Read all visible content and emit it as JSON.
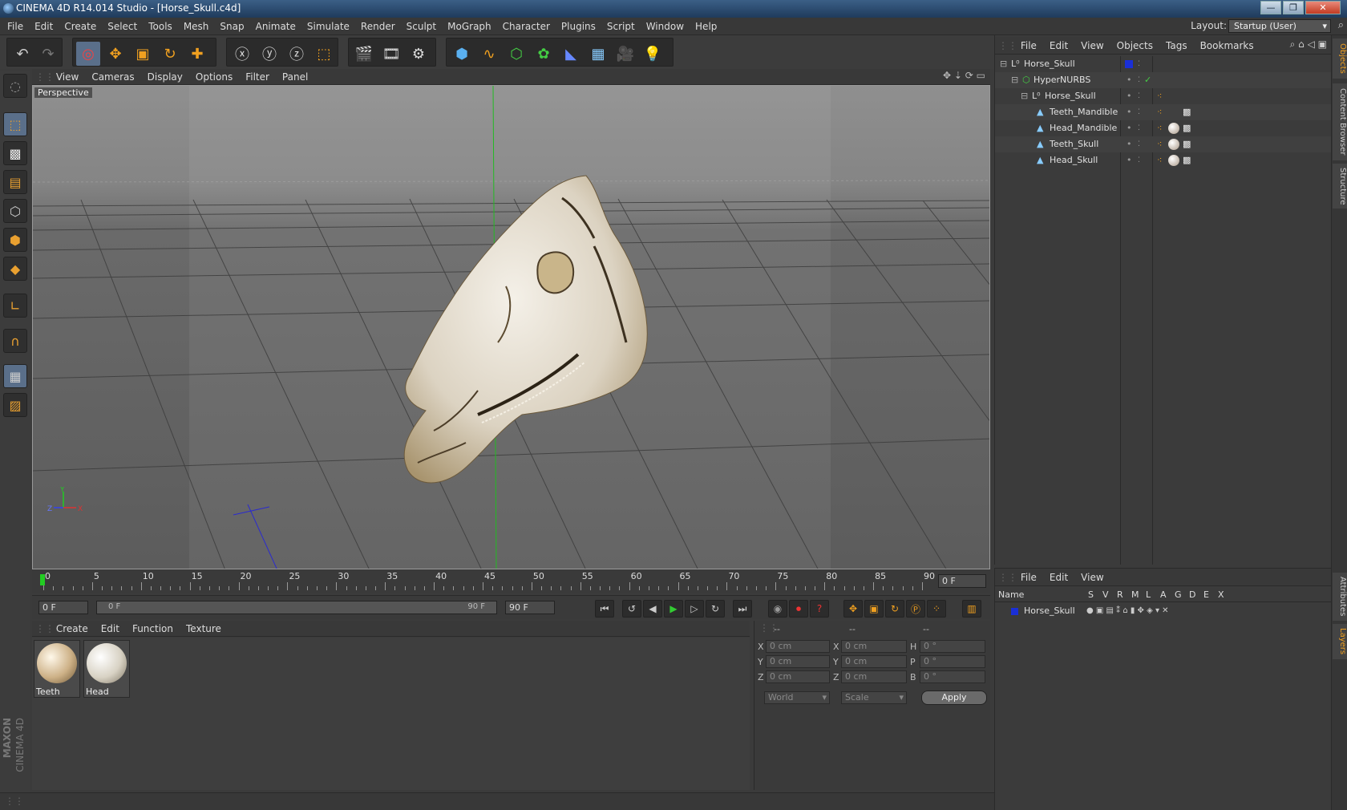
{
  "window": {
    "title": "CINEMA 4D R14.014 Studio - [Horse_Skull.c4d]",
    "min": "—",
    "max": "❐",
    "close": "✕"
  },
  "menu": [
    "File",
    "Edit",
    "Create",
    "Select",
    "Tools",
    "Mesh",
    "Snap",
    "Animate",
    "Simulate",
    "Render",
    "Sculpt",
    "MoGraph",
    "Character",
    "Plugins",
    "Script",
    "Window",
    "Help"
  ],
  "layout": {
    "label": "Layout:",
    "value": "Startup (User)"
  },
  "viewport": {
    "menu": [
      "View",
      "Cameras",
      "Display",
      "Options",
      "Filter",
      "Panel"
    ],
    "label": "Perspective",
    "axis": {
      "y": "Y",
      "x": "X",
      "z": "Z"
    }
  },
  "timeline": {
    "ticks": [
      "0",
      "5",
      "10",
      "15",
      "20",
      "25",
      "30",
      "35",
      "40",
      "45",
      "50",
      "55",
      "60",
      "65",
      "70",
      "75",
      "80",
      "85",
      "90"
    ],
    "frame_field": "0 F"
  },
  "playback": {
    "start": "0 F",
    "range_start": "0 F",
    "range_end": "90 F",
    "end": "90 F"
  },
  "materials": {
    "menu": [
      "Create",
      "Edit",
      "Function",
      "Texture"
    ],
    "items": [
      {
        "name": "Teeth"
      },
      {
        "name": "Head"
      }
    ]
  },
  "coords": {
    "head": [
      "--",
      "--",
      "--"
    ],
    "rows": [
      {
        "a": "X",
        "v1": "0 cm",
        "b": "X",
        "v2": "0 cm",
        "c": "H",
        "v3": "0 °"
      },
      {
        "a": "Y",
        "v1": "0 cm",
        "b": "Y",
        "v2": "0 cm",
        "c": "P",
        "v3": "0 °"
      },
      {
        "a": "Z",
        "v1": "0 cm",
        "b": "Z",
        "v2": "0 cm",
        "c": "B",
        "v3": "0 °"
      }
    ],
    "world": "World",
    "scale": "Scale",
    "apply": "Apply"
  },
  "objects": {
    "menu": [
      "File",
      "Edit",
      "View",
      "Objects",
      "Tags",
      "Bookmarks"
    ],
    "tree": [
      {
        "name": "Horse_Skull",
        "indent": 0
      },
      {
        "name": "HyperNURBS",
        "indent": 1
      },
      {
        "name": "Horse_Skull",
        "indent": 2
      },
      {
        "name": "Teeth_Mandible",
        "indent": 3
      },
      {
        "name": "Head_Mandible",
        "indent": 3
      },
      {
        "name": "Teeth_Skull",
        "indent": 3
      },
      {
        "name": "Head_Skull",
        "indent": 3
      }
    ]
  },
  "right_tabs": [
    "Objects",
    "Content Browser",
    "Structure",
    "Attributes",
    "Layers"
  ],
  "layers": {
    "menu": [
      "File",
      "Edit",
      "View"
    ],
    "columns": [
      "Name",
      "S",
      "V",
      "R",
      "M",
      "L",
      "A",
      "G",
      "D",
      "E",
      "X"
    ],
    "rows": [
      {
        "name": "Horse_Skull"
      }
    ]
  },
  "branding": {
    "maxon": "MAXON",
    "product": "CINEMA 4D"
  },
  "colors": {
    "accent": "#f0a020",
    "blue_layer": "#1a2fd6",
    "green_axis": "#20b020"
  }
}
